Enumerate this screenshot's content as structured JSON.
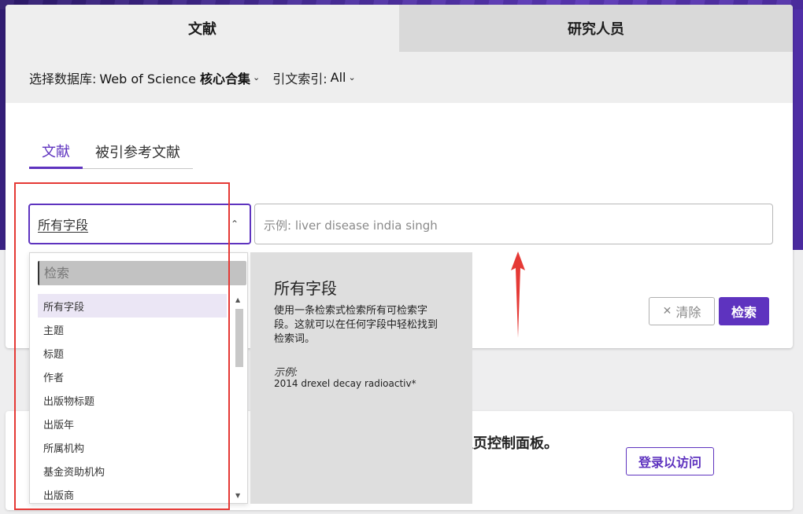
{
  "colors": {
    "accent": "#5e33bf",
    "annotation": "#e53935"
  },
  "top_tabs": [
    {
      "label": "文献",
      "active": true
    },
    {
      "label": "研究人员",
      "active": false
    }
  ],
  "db_bar": {
    "database_label": "选择数据库:",
    "database_value_prefix": "Web of Science",
    "database_value_bold": "核心合集",
    "citation_label": "引文索引:",
    "citation_value": "All"
  },
  "sub_tabs": [
    {
      "label": "文献",
      "active": true
    },
    {
      "label": "被引参考文献",
      "active": false
    }
  ],
  "search": {
    "field_selected": "所有字段",
    "query_placeholder": "示例: liver disease india singh",
    "clear_label": "清除",
    "submit_label": "检索"
  },
  "dropdown": {
    "search_placeholder": "检索",
    "items": [
      {
        "label": "所有字段",
        "selected": true
      },
      {
        "label": "主题"
      },
      {
        "label": "标题"
      },
      {
        "label": "作者"
      },
      {
        "label": "出版物标题"
      },
      {
        "label": "出版年"
      },
      {
        "label": "所属机构"
      },
      {
        "label": "基金资助机构"
      },
      {
        "label": "出版商"
      }
    ]
  },
  "preview": {
    "title": "所有字段",
    "description": "使用一条检索式检索所有可检索字段。这就可以在任何字段中轻松找到检索词。",
    "example_label": "示例:",
    "example": "2014 drexel decay radioactiv*"
  },
  "promo": {
    "text": "主页控制面板。",
    "login_label": "登录以访问"
  }
}
